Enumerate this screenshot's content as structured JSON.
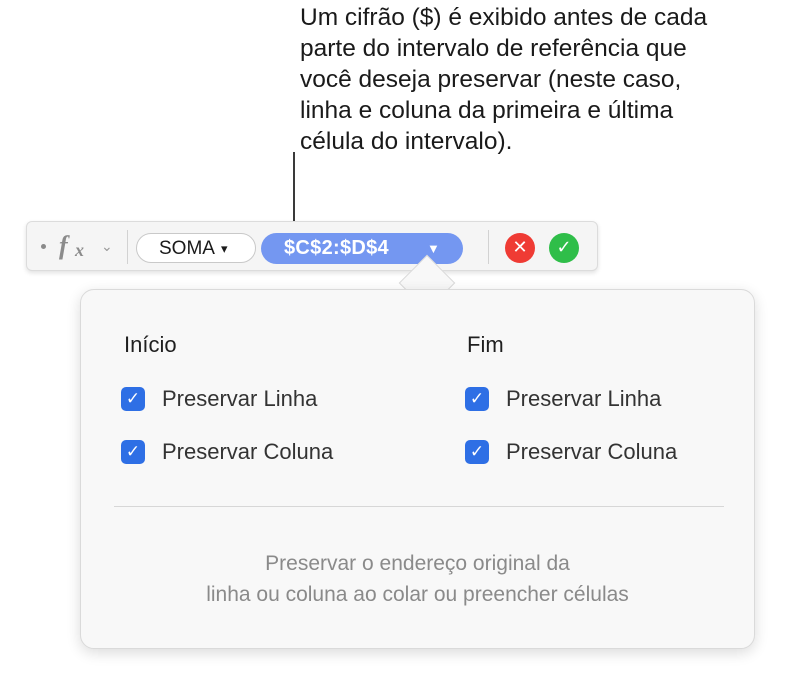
{
  "callout": {
    "lines": [
      "Um cifrão ($) é exibido antes de cada",
      "parte do intervalo de referência que",
      "você deseja preservar (neste caso,",
      "linha e coluna da primeira e última",
      "célula do intervalo)."
    ]
  },
  "formula_bar": {
    "fx_icon": "function-fx-icon",
    "fx_main": "f",
    "fx_sub": "x",
    "chevron": "⌄",
    "function_token": "SOMA",
    "function_arrow": "▾",
    "reference_token": "$C$2:$D$4",
    "reference_arrow": "▼",
    "cancel_glyph": "✕",
    "accept_glyph": "✓",
    "colors": {
      "reference_token": "#7497f1",
      "cancel": "#ef3b34",
      "accept": "#2fbe49"
    }
  },
  "popover": {
    "start_heading": "Início",
    "end_heading": "Fim",
    "start_options": [
      {
        "label": "Preservar Linha",
        "checked": true
      },
      {
        "label": "Preservar Coluna",
        "checked": true
      }
    ],
    "end_options": [
      {
        "label": "Preservar Linha",
        "checked": true
      },
      {
        "label": "Preservar Coluna",
        "checked": true
      }
    ],
    "checkbox_glyph": "✓",
    "footer_lines": [
      "Preservar o endereço original da",
      "linha ou coluna ao colar ou preencher células"
    ],
    "colors": {
      "checkbox": "#2e6fe5"
    }
  }
}
